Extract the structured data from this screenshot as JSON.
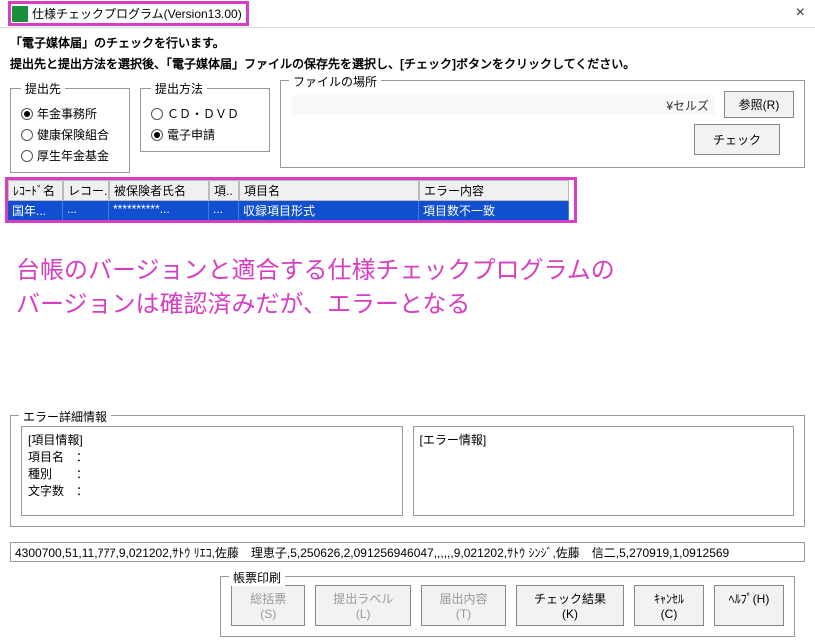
{
  "window": {
    "title": "仕様チェックプログラム(Version13.00)"
  },
  "intro": {
    "line1": "「電子媒体届」のチェックを行います。",
    "line2": "提出先と提出方法を選択後、「電子媒体届」ファイルの保存先を選択し、[チェック]ボタンをクリックしてください。"
  },
  "groups": {
    "dest": {
      "legend": "提出先",
      "opt1": "年金事務所",
      "opt2": "健康保険組合",
      "opt3": "厚生年金基金",
      "selected": 0
    },
    "method": {
      "legend": "提出方法",
      "opt1": "ＣＤ・ＤＶＤ",
      "opt2": "電子申請",
      "selected": 1
    },
    "file": {
      "legend": "ファイルの場所",
      "value": "¥セルズ",
      "browse": "参照(R)"
    }
  },
  "buttons": {
    "check": "チェック",
    "summary": "総括票(S)",
    "label": "提出ラベル(L)",
    "contents": "届出内容(T)",
    "result": "チェック結果(K)",
    "cancel": "ｷｬﾝｾﾙ(C)",
    "help": "ﾍﾙﾌﾟ(H)"
  },
  "grid": {
    "headers": {
      "h0": "ﾚｺｰﾄﾞ名",
      "h1": "レコー...",
      "h2": "被保険者氏名",
      "h3": "項..",
      "h4": "項目名",
      "h5": "エラー内容"
    },
    "row0": {
      "c0": "国年...",
      "c1": "...",
      "c2": "**********...",
      "c3": "...",
      "c4": "収録項目形式",
      "c5": "項目数不一致"
    }
  },
  "overlay": {
    "line1": "台帳のバージョンと適合する仕様チェックプログラムの",
    "line2": "バージョンは確認済みだが、エラーとなる"
  },
  "detail": {
    "legend": "エラー詳細情報",
    "left": {
      "l0": "[項目情報]",
      "l1": "項目名　：",
      "l2": "種別　　：",
      "l3": "文字数　："
    },
    "right": {
      "l0": "[エラー情報]"
    }
  },
  "raw": "4300700,51,11,ｱｱｱ,9,021202,ｻﾄｳ ﾘｴｺ,佐藤　理恵子,5,250626,2,091256946047,,,,,,9,021202,ｻﾄｳ ｼﾝｼﾞ,佐藤　信二,5,270919,1,0912569",
  "print": {
    "legend": "帳票印刷"
  }
}
